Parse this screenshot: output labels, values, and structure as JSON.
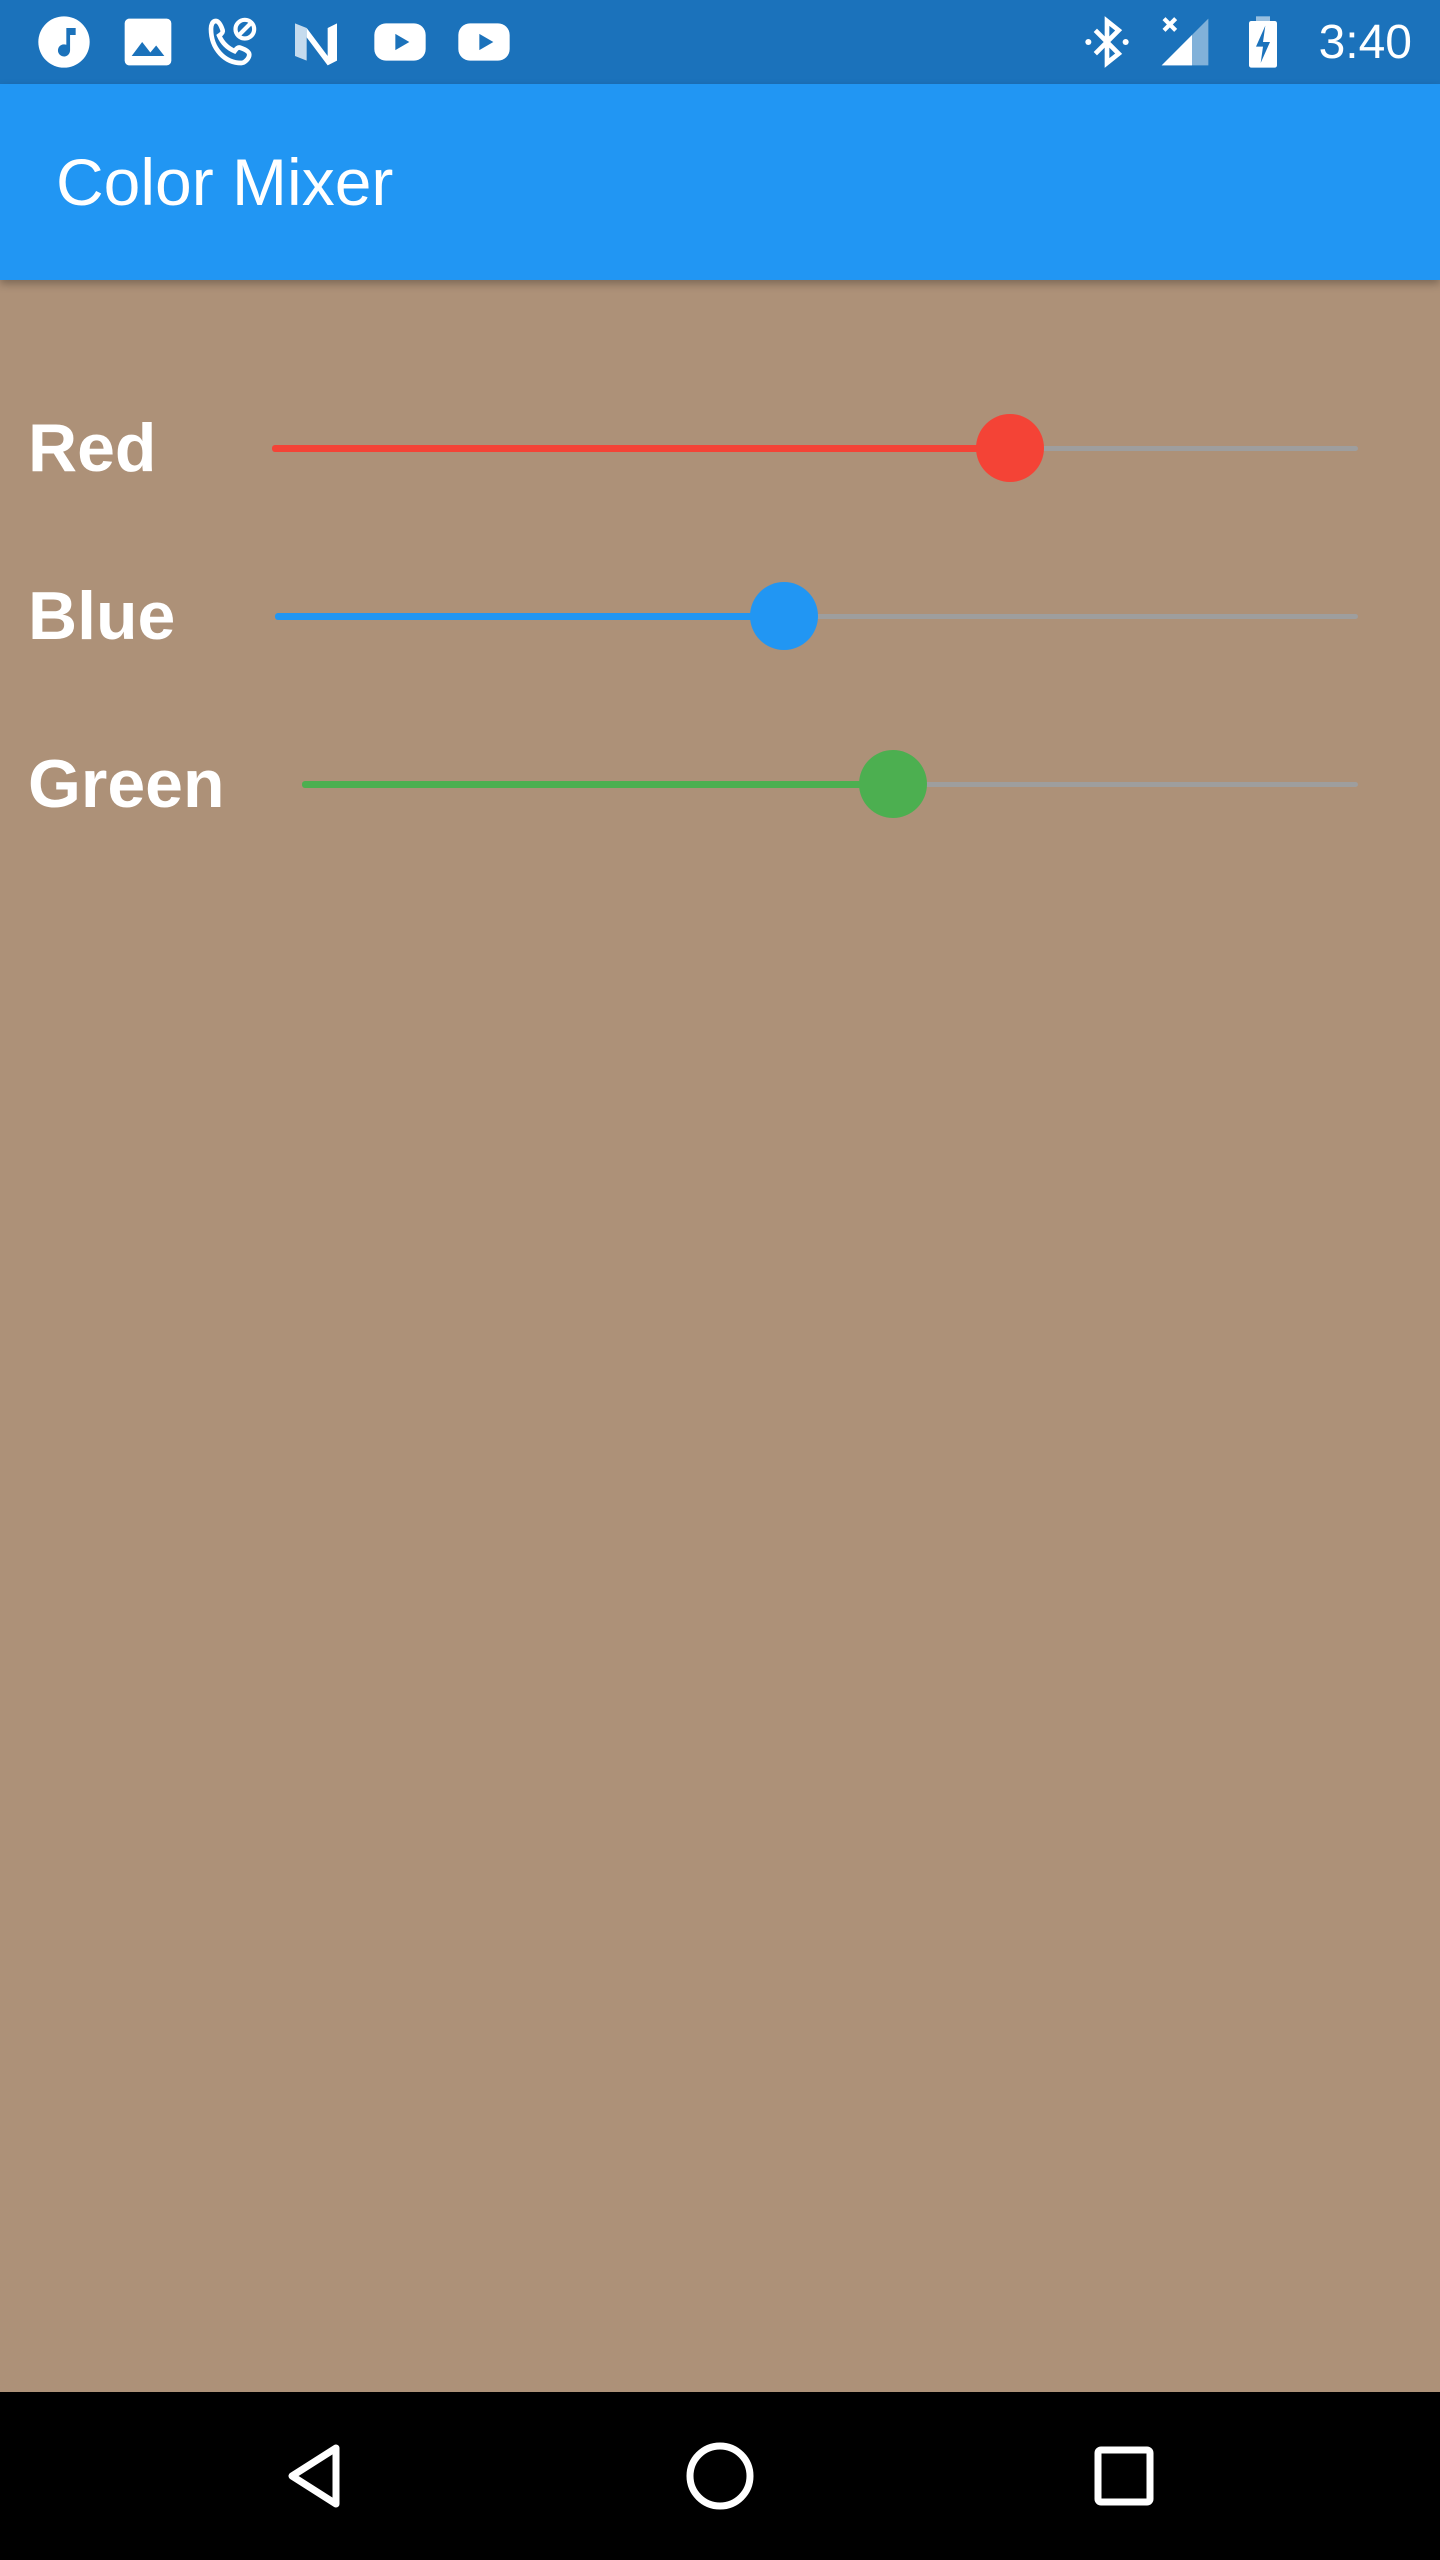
{
  "colors": {
    "status_bar": "#1b72bb",
    "app_bar": "#2196f3",
    "background": "#ad9178",
    "inactive_track": "#9e9e9e",
    "nav_bar": "#000000"
  },
  "status_bar": {
    "left_icons": [
      "music-note-icon",
      "image-icon",
      "call-blocked-icon",
      "n-logo-icon",
      "youtube-icon",
      "youtube-icon"
    ],
    "right_icons": [
      "bluetooth-icon",
      "signal-no-data-icon",
      "battery-charging-icon"
    ],
    "time": "3:40"
  },
  "app_bar": {
    "title": "Color Mixer"
  },
  "sliders": [
    {
      "label": "Red",
      "value": 0.68,
      "color": "#f44336"
    },
    {
      "label": "Blue",
      "value": 0.47,
      "color": "#2196f3"
    },
    {
      "label": "Green",
      "value": 0.56,
      "color": "#4caf50"
    }
  ],
  "nav_bar": {
    "buttons": [
      "back-icon",
      "home-icon",
      "recents-icon"
    ]
  }
}
